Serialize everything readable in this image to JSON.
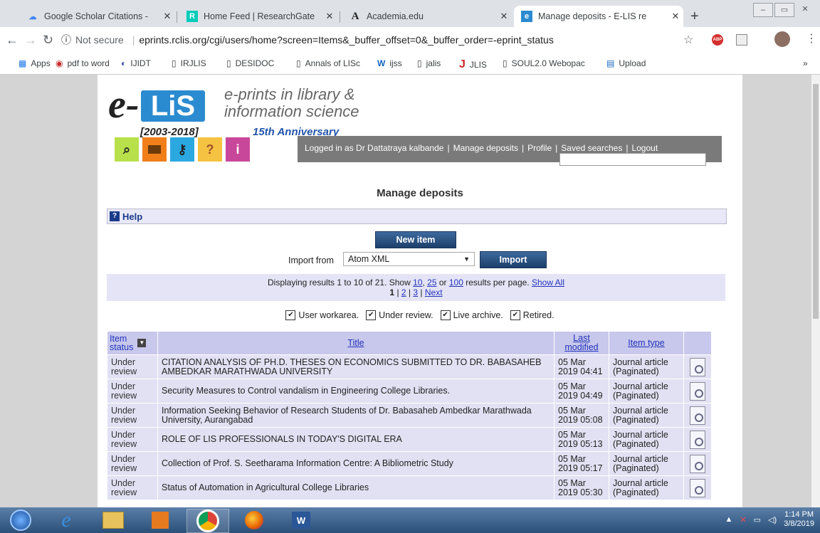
{
  "browser": {
    "tabs": [
      {
        "title": "Google Scholar Citations -",
        "icon": "G",
        "active": false
      },
      {
        "title": "Home Feed | ResearchGate",
        "icon": "R",
        "active": false
      },
      {
        "title": "Academia.edu",
        "icon": "A",
        "active": false
      },
      {
        "title": "Manage deposits - E-LIS re",
        "icon": "e",
        "active": true
      }
    ],
    "tab_close": "✕",
    "new_tab": "+",
    "security": "Not secure",
    "url": "eprints.rclis.org/cgi/users/home?screen=Items&_buffer_offset=0&_buffer_order=-eprint_status",
    "bookmarks": [
      "Apps",
      "pdf to word",
      "IJIDT",
      "IRJLIS",
      "DESIDOC",
      "Annals of LISc",
      "ijss",
      "jalis",
      "JLIS",
      "SOUL2.0 Webopac",
      "Upload"
    ],
    "bookmark_overflow": "»"
  },
  "site": {
    "logo_e": "e-",
    "logo_lis": "LiS",
    "logo_years": "[2003-2018]",
    "tagline_1": "e-prints in library &",
    "tagline_2": "information science",
    "anniversary": "15th  Anniversary",
    "user_menu": {
      "logged_in": "Logged in as Dr Dattatraya kalbande",
      "manage": "Manage deposits",
      "profile": "Profile",
      "saved": "Saved searches",
      "logout": "Logout"
    }
  },
  "main": {
    "title": "Manage deposits",
    "help": "Help",
    "new_item": "New item",
    "import_label": "Import from",
    "import_selected": "Atom XML",
    "import_button": "Import",
    "results": {
      "prefix": "Displaying results 1 to 10 of 21. Show",
      "opt_10": "10",
      "opt_25": "25",
      "or": "or",
      "opt_100": "100",
      "suffix": "results per page.",
      "show_all": "Show All",
      "page_1": "1",
      "page_2": "2",
      "page_3": "3",
      "next": "Next"
    },
    "filters": [
      "User workarea.",
      "Under review.",
      "Live archive.",
      "Retired."
    ],
    "table": {
      "headers": {
        "status_1": "Item",
        "status_2": "status",
        "title": "Title",
        "modified_1": "Last",
        "modified_2": "modified",
        "type": "Item type"
      },
      "rows": [
        {
          "s1": "Under",
          "s2": "review",
          "title": "CITATION ANALYSIS OF PH.D. THESES ON ECONOMICS SUBMITTED TO DR. BABASAHEB AMBEDKAR MARATHWADA UNIVERSITY",
          "d1": "05 Mar",
          "d2": "2019 04:41",
          "t1": "Journal article",
          "t2": "(Paginated)"
        },
        {
          "s1": "Under",
          "s2": "review",
          "title": "Security Measures to Control vandalism in Engineering College Libraries.",
          "d1": "05 Mar",
          "d2": "2019 04:49",
          "t1": "Journal article",
          "t2": "(Paginated)"
        },
        {
          "s1": "Under",
          "s2": "review",
          "title": "Information Seeking Behavior of Research Students of Dr. Babasaheb Ambedkar Marathwada University, Aurangabad",
          "d1": "05 Mar",
          "d2": "2019 05:08",
          "t1": "Journal article",
          "t2": "(Paginated)"
        },
        {
          "s1": "Under",
          "s2": "review",
          "title": "ROLE OF LIS PROFESSIONALS IN TODAY'S DIGITAL ERA",
          "d1": "05 Mar",
          "d2": "2019 05:13",
          "t1": "Journal article",
          "t2": "(Paginated)"
        },
        {
          "s1": "Under",
          "s2": "review",
          "title": "Collection of Prof. S. Seetharama Information Centre: A Bibliometric Study",
          "d1": "05 Mar",
          "d2": "2019 05:17",
          "t1": "Journal article",
          "t2": "(Paginated)"
        },
        {
          "s1": "Under",
          "s2": "review",
          "title": "Status of Automation in Agricultural College Libraries",
          "d1": "05 Mar",
          "d2": "2019 05:30",
          "t1": "Journal article",
          "t2": "(Paginated)"
        }
      ]
    }
  },
  "taskbar": {
    "time": "1:14 PM",
    "date": "3/8/2019"
  },
  "colors": {
    "accent": "#1c3f6a",
    "row_bg": "#e1e1f3",
    "header_bg": "#c8c8ec"
  }
}
